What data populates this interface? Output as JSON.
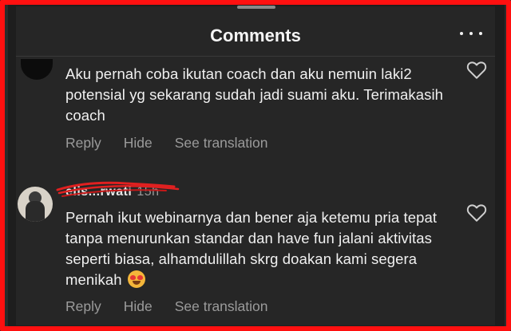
{
  "header": {
    "title": "Comments",
    "more_icon": "more-horizontal-icon"
  },
  "comments": [
    {
      "username": "",
      "timestamp": "",
      "text": "Aku pernah coba ikutan coach dan aku nemuin laki2 potensial yg sekarang sudah jadi suami aku. Terimakasih coach",
      "actions": {
        "reply": "Reply",
        "hide": "Hide",
        "translate": "See translation"
      },
      "like_icon": "heart-outline-icon"
    },
    {
      "username": "elis...rwati",
      "timestamp": "15h",
      "text": "Pernah ikut webinarnya dan bener aja ketemu pria tepat tanpa menurunkan standar dan have fun jalani aktivitas seperti biasa, alhamdulillah skrg doakan kami segera menikah",
      "emoji": "heart-eyes-emoji",
      "actions": {
        "reply": "Reply",
        "hide": "Hide",
        "translate": "See translation"
      },
      "like_icon": "heart-outline-icon"
    }
  ],
  "colors": {
    "background": "#262626",
    "text": "#f0f0f0",
    "muted": "#9b9b9b",
    "annotation_border": "#ff1010",
    "redaction": "#e02020"
  }
}
